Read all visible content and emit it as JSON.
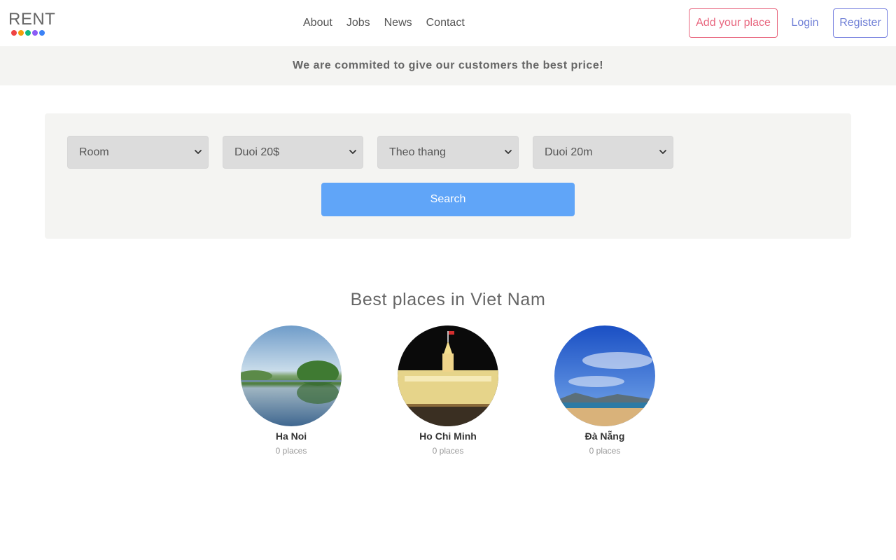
{
  "header": {
    "logo_text": "RENT",
    "logo_dots": [
      "#ef4444",
      "#f59e0b",
      "#10b981",
      "#8b5cf6",
      "#3b82f6"
    ],
    "nav": [
      {
        "label": "About"
      },
      {
        "label": "Jobs"
      },
      {
        "label": "News"
      },
      {
        "label": "Contact"
      }
    ],
    "add_place_label": "Add your place",
    "login_label": "Login",
    "register_label": "Register"
  },
  "banner": {
    "text": "We are commited to give our customers the best price!"
  },
  "search": {
    "type_select": "Room",
    "price_select": "Duoi 20$",
    "period_select": "Theo thang",
    "area_select": "Duoi 20m",
    "button_label": "Search",
    "button_color": "#60a5f8"
  },
  "places": {
    "title": "Best places in Viet Nam",
    "items": [
      {
        "name": "Ha Noi",
        "count": "0 places"
      },
      {
        "name": "Ho Chi Minh",
        "count": "0 places"
      },
      {
        "name": "Đà Nẵng",
        "count": "0 places"
      }
    ]
  },
  "colors": {
    "accent_pink": "#e8677f",
    "accent_indigo": "#6f7fd6",
    "panel_bg": "#f4f4f2"
  }
}
